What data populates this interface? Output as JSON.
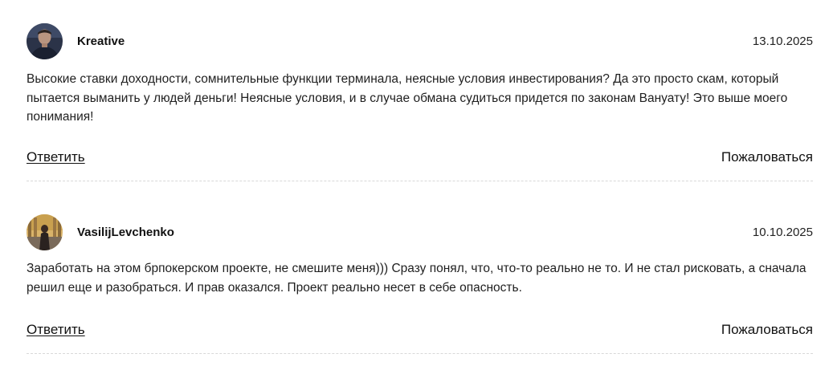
{
  "comments": [
    {
      "author": "Kreative",
      "date": "13.10.2025",
      "text": "Высокие ставки доходности, сомнительные функции терминала, неясные условия инвестирования? Да это просто скам, который пытается выманить у людей деньги! Неясные условия, и в случае обмана судиться придется по законам Вануату! Это выше моего понимания!",
      "reply_label": "Ответить",
      "complain_label": "Пожаловаться",
      "avatar_icon": "user-photo-avatar"
    },
    {
      "author": "VasilijLevchenko",
      "date": "10.10.2025",
      "text": "Заработать на этом брпокерском проекте, не смешите меня))) Сразу понял, что, что-то реально не то. И не стал рисковать, а сначала решил еще и разобраться. И прав оказался. Проект реально несет в себе опасность.",
      "reply_label": "Ответить",
      "complain_label": "Пожаловаться",
      "avatar_icon": "user-photo-avatar"
    }
  ]
}
